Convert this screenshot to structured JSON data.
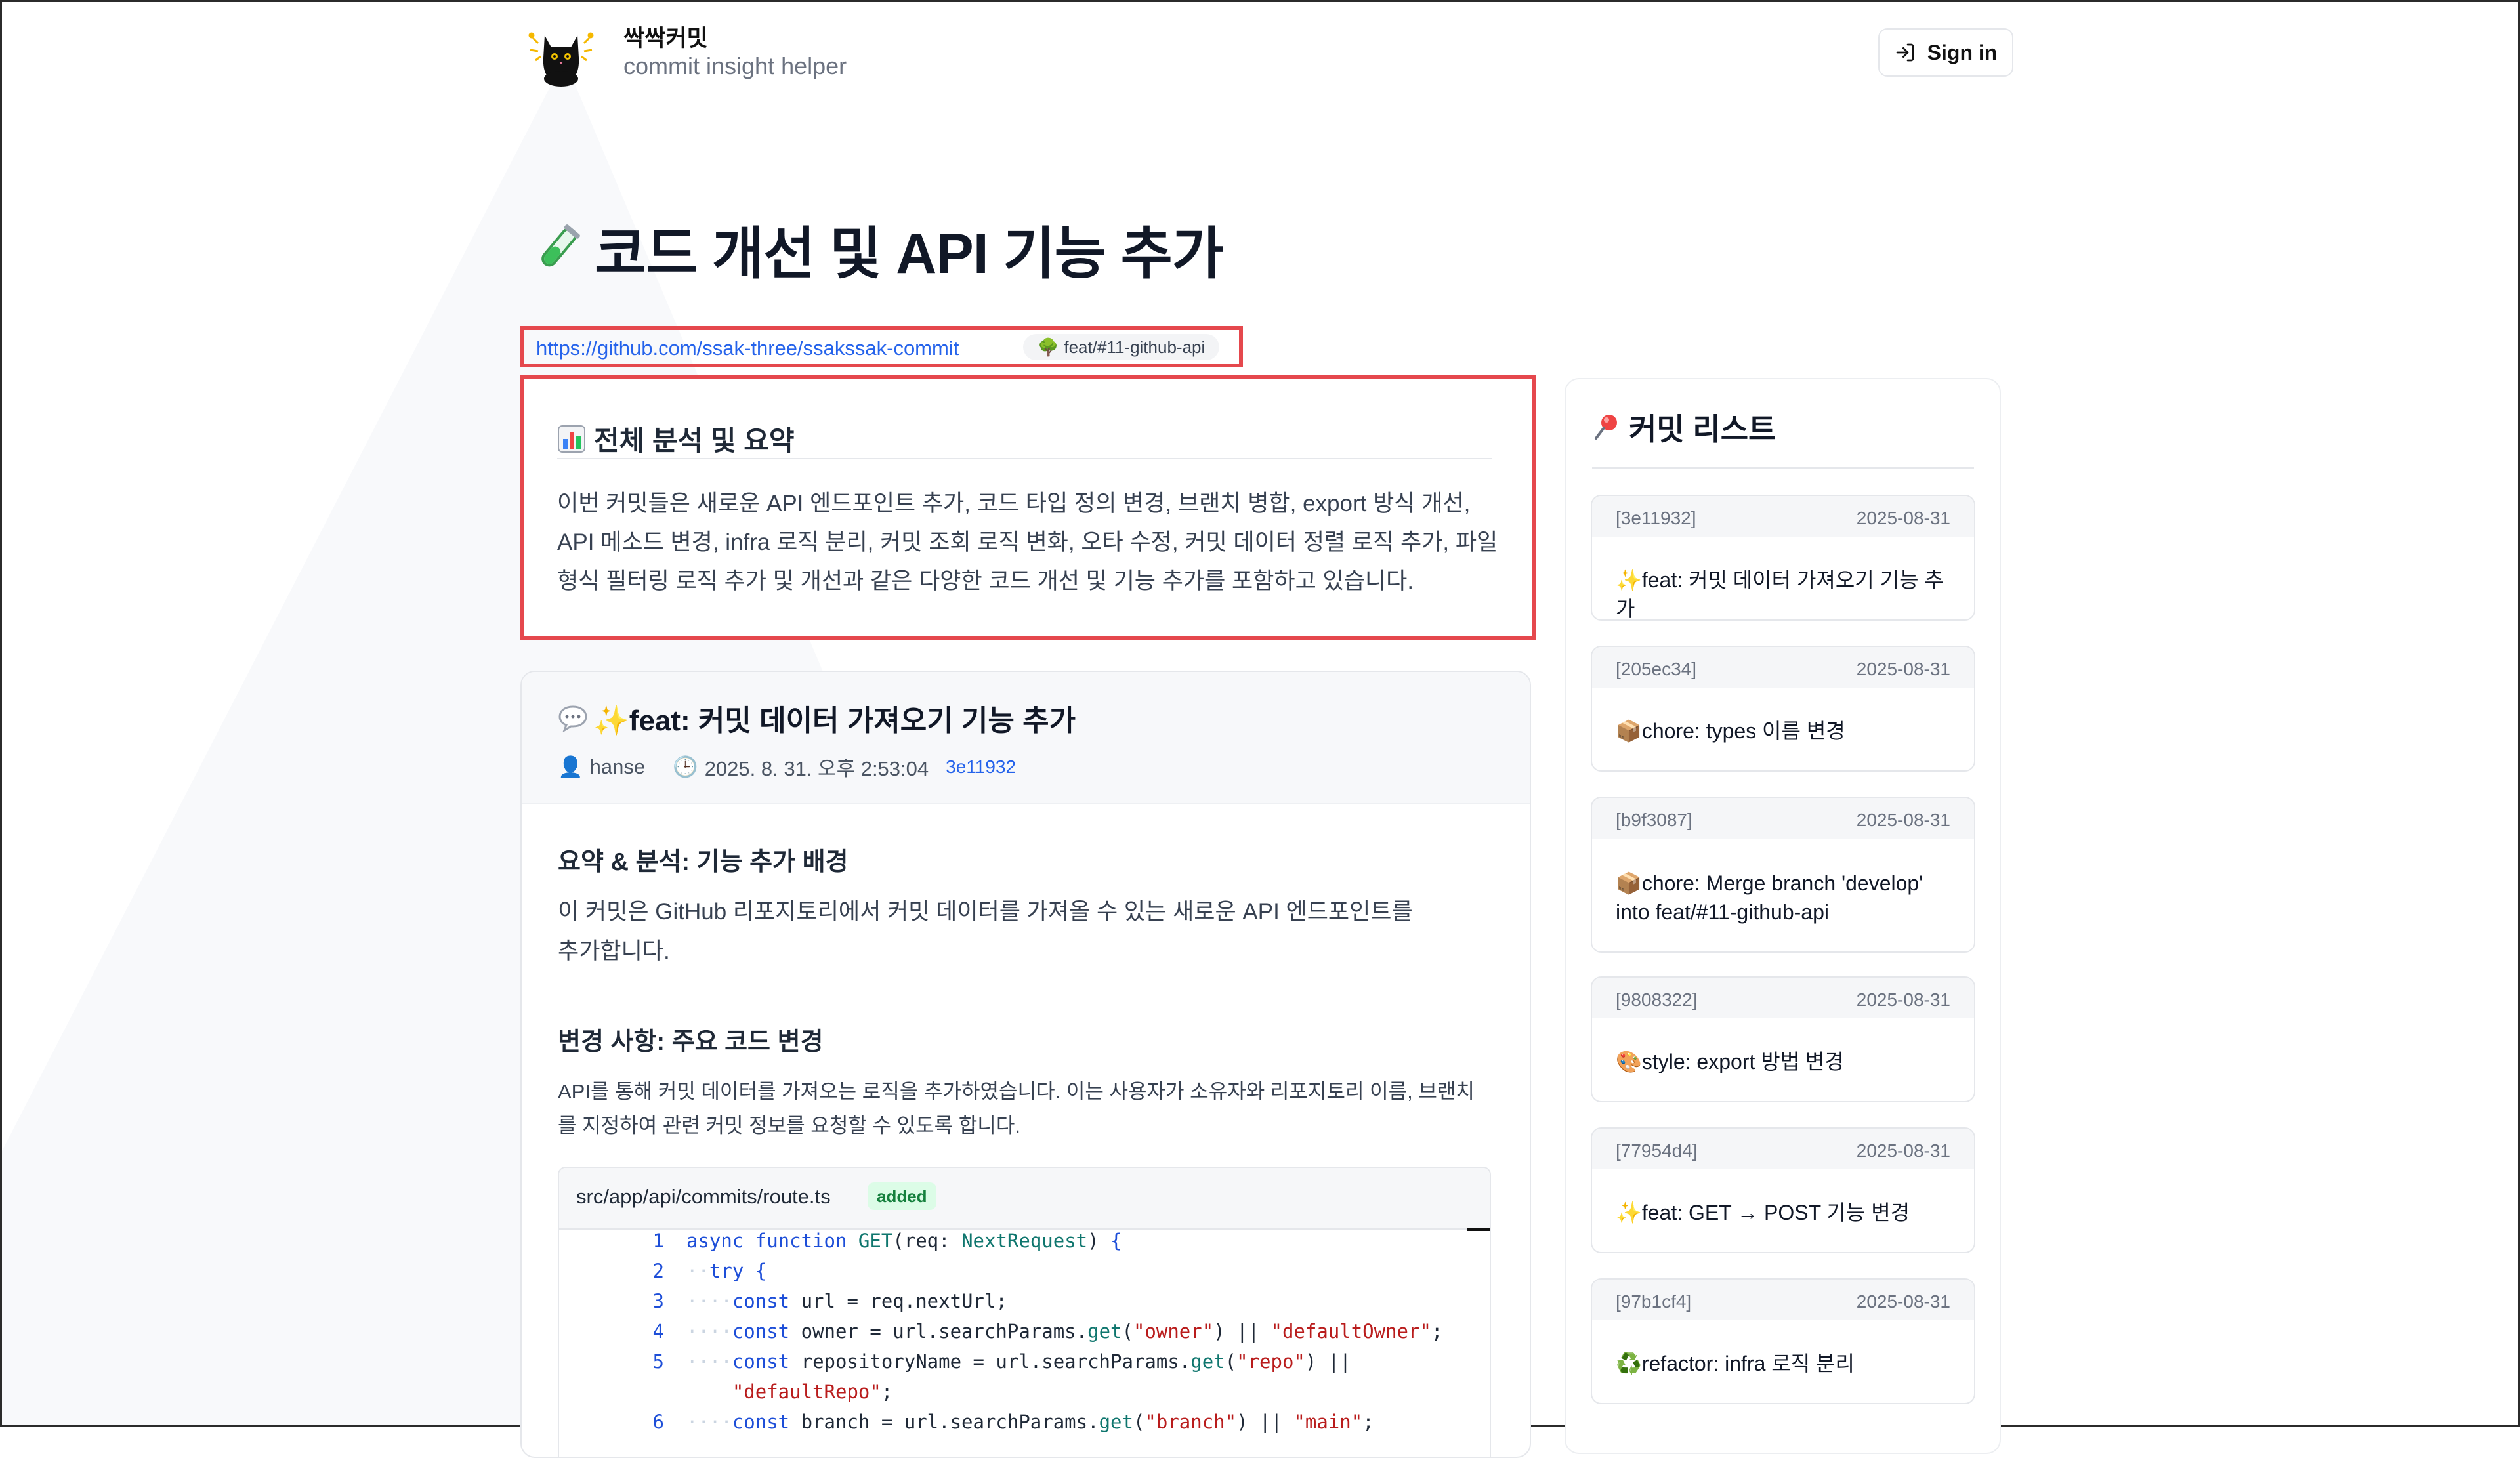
{
  "brand": {
    "name": "싹싹커밋",
    "subtitle": "commit insight helper"
  },
  "header": {
    "signin_label": "Sign in"
  },
  "page": {
    "title": "코드 개선 및 API 기능 추가",
    "title_icon": "test-tube-icon"
  },
  "repo": {
    "url": "https://github.com/ssak-three/ssakssak-commit",
    "branch": "feat/#11-github-api"
  },
  "summary": {
    "title": "전체 분석 및 요약",
    "text": "이번 커밋들은 새로운 API 엔드포인트 추가, 코드 타입 정의 변경, 브랜치 병합, export 방식 개선, API 메소드 변경, infra 로직 분리, 커밋 조회 로직 변화, 오타 수정, 커밋 데이터 정렬 로직 추가, 파일 형식 필터링 로직 추가 및 개선과 같은 다양한 코드 개선 및 기능 추가를 포함하고 있습니다."
  },
  "commit": {
    "title": "✨feat: 커밋 데이터 가져오기 기능 추가",
    "author": "hanse",
    "datetime": "2025. 8. 31. 오후 2:53:04",
    "hash": "3e11932",
    "section1_title": "요약 & 분석: 기능 추가 배경",
    "section1_text": "이 커밋은 GitHub 리포지토리에서 커밋 데이터를 가져올 수 있는 새로운 API 엔드포인트를 추가합니다.",
    "section2_title": "변경 사항: 주요 코드 변경",
    "section2_text": "API를 통해 커밋 데이터를 가져오는 로직을 추가하였습니다. 이는 사용자가 소유자와 리포지토리 이름, 브랜치를 지정하여 관련 커밋 정보를 요청할 수 있도록 합니다.",
    "file": {
      "path": "src/app/api/commits/route.ts",
      "status": "added"
    },
    "code_line_numbers": [
      "1",
      "2",
      "3",
      "4",
      "5",
      "",
      "6"
    ]
  },
  "sidebar": {
    "title": "커밋 리스트",
    "items": [
      {
        "hash": "[3e11932]",
        "date": "2025-08-31",
        "message": "✨feat: 커밋 데이터 가져오기 기능 추가"
      },
      {
        "hash": "[205ec34]",
        "date": "2025-08-31",
        "message": "📦chore: types 이름 변경"
      },
      {
        "hash": "[b9f3087]",
        "date": "2025-08-31",
        "message": "📦chore: Merge branch 'develop' into feat/#11-github-api"
      },
      {
        "hash": "[9808322]",
        "date": "2025-08-31",
        "message": "🎨style: export 방법 변경"
      },
      {
        "hash": "[77954d4]",
        "date": "2025-08-31",
        "message": "✨feat: GET → POST 기능 변경"
      },
      {
        "hash": "[97b1cf4]",
        "date": "2025-08-31",
        "message": "♻️refactor: infra 로직 분리"
      }
    ]
  }
}
